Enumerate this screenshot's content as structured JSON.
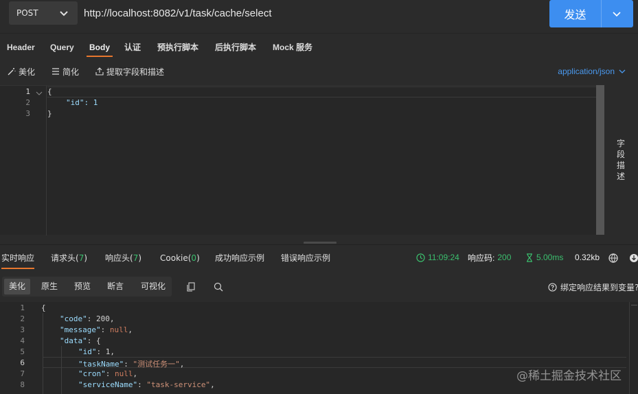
{
  "request": {
    "method": "POST",
    "url": "http://localhost:8082/v1/task/cache/select",
    "send_label": "发送"
  },
  "request_tabs": [
    {
      "label": "Header",
      "active": false
    },
    {
      "label": "Query",
      "active": false
    },
    {
      "label": "Body",
      "active": true
    },
    {
      "label": "认证",
      "active": false
    },
    {
      "label": "预执行脚本",
      "active": false
    },
    {
      "label": "后执行脚本",
      "active": false
    },
    {
      "label": "Mock 服务",
      "active": false
    }
  ],
  "body_toolbar": {
    "beautify": "美化",
    "simplify": "简化",
    "extract": "提取字段和描述",
    "content_type": "application/json"
  },
  "request_body": {
    "line_numbers": [
      "1",
      "2",
      "3"
    ],
    "lines": [
      "{",
      "\"id\": 1",
      "}"
    ]
  },
  "field_description_label": "字段描述",
  "response_tabs": {
    "realtime": "实时响应",
    "req_headers": "请求头(",
    "req_headers_count": "7",
    "resp_headers": "响应头(",
    "resp_headers_count": "7",
    "cookie": "Cookie(",
    "cookie_count": "0",
    "close_paren": ")",
    "success_example": "成功响应示例",
    "error_example": "错误响应示例"
  },
  "response_meta": {
    "time": "11:09:24",
    "status_label": "响应码:",
    "status_code": "200",
    "duration": "5.00ms",
    "size": "0.32kb"
  },
  "view_tabs": [
    {
      "label": "美化",
      "active": true
    },
    {
      "label": "原生",
      "active": false
    },
    {
      "label": "预览",
      "active": false
    },
    {
      "label": "断言",
      "active": false
    },
    {
      "label": "可视化",
      "active": false
    }
  ],
  "bind_hint": "绑定响应结果到变量?",
  "response_body": {
    "line_numbers": [
      "1",
      "2",
      "3",
      "4",
      "5",
      "6",
      "7",
      "8"
    ],
    "lines": [
      {
        "key": "",
        "text": "{"
      },
      {
        "key": "\"code\"",
        "value": "200",
        "vtype": "num"
      },
      {
        "key": "\"message\"",
        "value": "null",
        "vtype": "kw"
      },
      {
        "key": "\"data\"",
        "value": "{",
        "vtype": "punct"
      },
      {
        "key": "\"id\"",
        "value": "1",
        "vtype": "num"
      },
      {
        "key": "\"taskName\"",
        "value": "\"测试任务一\"",
        "vtype": "str"
      },
      {
        "key": "\"cron\"",
        "value": "null",
        "vtype": "kw"
      },
      {
        "key": "\"serviceName\"",
        "value": "\"task-service\"",
        "vtype": "str"
      }
    ],
    "current_line": "6"
  },
  "watermark": "@稀土掘金技术社区",
  "colors": {
    "accent_orange": "#e8772e",
    "send_blue": "#3d8ef0",
    "success_green": "#3bbf6e",
    "link_blue": "#4a9af0"
  },
  "icons": [
    "chevron-down-icon",
    "magic-wand-icon",
    "list-icon",
    "share-icon",
    "clock-icon",
    "hourglass-icon",
    "globe-icon",
    "download-icon",
    "copy-icon",
    "search-icon",
    "help-circle-icon"
  ]
}
